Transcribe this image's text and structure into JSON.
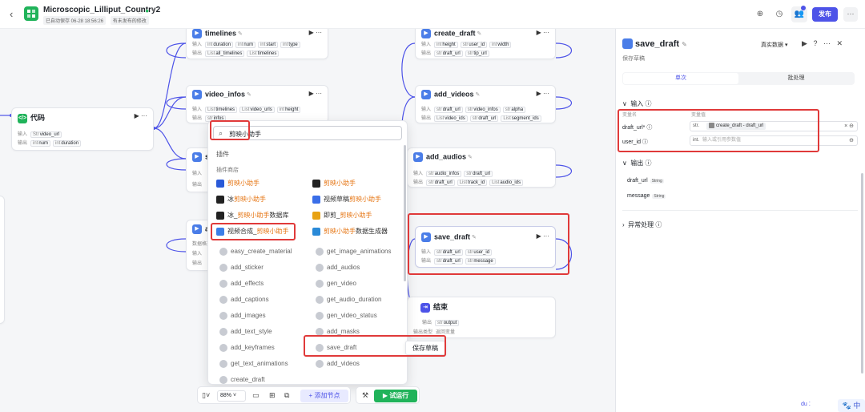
{
  "app": {
    "title": "Microscopic_Lilliput_Country2",
    "autosave": "已自动保存 06-28 18:56:26",
    "unpublished": "有未发布的修改",
    "publish_label": "发布",
    "back_icon": "chevron-left-icon"
  },
  "nodes": {
    "code": {
      "title": "代码",
      "in_label": "输入",
      "out_label": "输出",
      "in": [
        {
          "type": "Str",
          "name": "video_url"
        }
      ],
      "out": [
        {
          "type": "int",
          "name": "num"
        },
        {
          "type": "int",
          "name": "duration"
        }
      ]
    },
    "timelines": {
      "title": "timelines",
      "in_label": "输入",
      "out_label": "输出",
      "in": [
        {
          "type": "int",
          "name": "duration"
        },
        {
          "type": "int",
          "name": "num"
        },
        {
          "type": "int",
          "name": "start"
        },
        {
          "type": "int",
          "name": "type"
        }
      ],
      "out": [
        {
          "type": "List",
          "name": "all_timelines"
        },
        {
          "type": "List",
          "name": "timelines"
        }
      ]
    },
    "video_infos": {
      "title": "video_infos",
      "in_label": "输入",
      "out_label": "输出",
      "in": [
        {
          "type": "List",
          "name": "timelines"
        },
        {
          "type": "List",
          "name": "video_urls"
        },
        {
          "type": "int",
          "name": "height"
        }
      ],
      "out": [
        {
          "type": "str",
          "name": "infos"
        }
      ]
    },
    "create_draft": {
      "title": "create_draft",
      "in_label": "输入",
      "out_label": "输出",
      "in": [
        {
          "type": "int",
          "name": "height"
        },
        {
          "type": "str",
          "name": "user_id"
        },
        {
          "type": "int",
          "name": "width"
        }
      ],
      "out": [
        {
          "type": "str",
          "name": "draft_url"
        },
        {
          "type": "str",
          "name": "tip_url"
        }
      ]
    },
    "add_videos": {
      "title": "add_videos",
      "in_label": "输入",
      "out_label": "输出",
      "in": [
        {
          "type": "str",
          "name": "draft_url"
        },
        {
          "type": "str",
          "name": "video_infos"
        },
        {
          "type": "str",
          "name": "alpha"
        }
      ],
      "out": [
        {
          "type": "List",
          "name": "video_ids"
        },
        {
          "type": "str",
          "name": "draft_url"
        },
        {
          "type": "List",
          "name": "segment_ids"
        }
      ]
    },
    "add_audios": {
      "title": "add_audios",
      "in_label": "输入",
      "out_label": "输出",
      "in": [
        {
          "type": "str",
          "name": "audio_infos"
        },
        {
          "type": "str",
          "name": "draft_url"
        }
      ],
      "out": [
        {
          "type": "str",
          "name": "draft_url"
        },
        {
          "type": "List",
          "name": "track_id"
        },
        {
          "type": "List",
          "name": "audio_ids"
        }
      ]
    },
    "save_draft": {
      "title": "save_draft",
      "in_label": "输入",
      "out_label": "输出",
      "in": [
        {
          "type": "str",
          "name": "draft_url"
        },
        {
          "type": "str",
          "name": "user_id"
        }
      ],
      "out": [
        {
          "type": "str",
          "name": "draft_url"
        },
        {
          "type": "str",
          "name": "message"
        }
      ]
    },
    "end": {
      "title": "结束",
      "out_label": "输出",
      "out": [
        {
          "type": "str",
          "name": "output"
        }
      ],
      "return_label": "输出类型",
      "return_value": "返回变量"
    },
    "partial_s": {
      "title": "st",
      "in_label": "输入",
      "out_label": "输出"
    },
    "partial_a": {
      "title": "a",
      "line1": "数据格式",
      "in_label": "输入",
      "out_label": "输出"
    }
  },
  "popup": {
    "query": "剪映小助手",
    "section_plugins": "插件",
    "section_store": "插件商店",
    "store_items": [
      {
        "prefix": "",
        "hl": "剪映小助手",
        "suffix": ""
      },
      {
        "prefix": "",
        "hl": "剪映小助手",
        "suffix": ""
      },
      {
        "prefix": "冰",
        "hl": "剪映小助手",
        "suffix": ""
      },
      {
        "prefix": "视频草稿",
        "hl": "剪映小助手",
        "suffix": ""
      },
      {
        "prefix": "冰_",
        "hl": "剪映小助手",
        "suffix": "数据库"
      },
      {
        "prefix": "即剪_",
        "hl": "剪映小助手",
        "suffix": ""
      },
      {
        "prefix": "视频合成_",
        "hl": "剪映小助手",
        "suffix": ""
      },
      {
        "prefix": "",
        "hl": "剪映小助手",
        "suffix": "数据生成器"
      }
    ],
    "tools_left": [
      "easy_create_material",
      "add_sticker",
      "add_effects",
      "add_captions",
      "add_images",
      "add_text_style",
      "add_keyframes",
      "get_text_animations",
      "create_draft"
    ],
    "tools_right": [
      "get_image_animations",
      "add_audios",
      "gen_video",
      "get_audio_duration",
      "gen_video_status",
      "add_masks",
      "save_draft",
      "add_videos"
    ],
    "tooltip": "保存草稿"
  },
  "toolbar": {
    "zoom": "88%",
    "add_node": "添加节点",
    "run": "试运行"
  },
  "panel": {
    "title": "save_draft",
    "desc": "保存草稿",
    "test_data": "真实数据",
    "tab_single": "单次",
    "tab_batch": "批处理",
    "input_title": "输入",
    "col_name": "变量名",
    "col_value": "变量值",
    "fields": [
      {
        "label": "draft_url*",
        "type": "str.",
        "value": "create_draft - draft_url"
      },
      {
        "label": "user_id",
        "type": "int.",
        "placeholder": "输入或引用参数值"
      }
    ],
    "output_title": "输出",
    "outputs": [
      {
        "name": "draft_url",
        "type": "String"
      },
      {
        "name": "message",
        "type": "String"
      }
    ],
    "exception_title": "异常处理"
  },
  "corner": {
    "ime": "中"
  },
  "colors": {
    "accent": "#4d53e8",
    "green": "#20b35a",
    "highlight": "#e67614",
    "annotation": "#e03a3a"
  }
}
